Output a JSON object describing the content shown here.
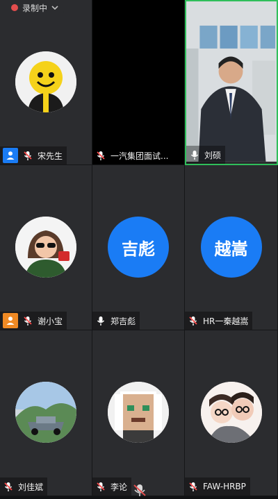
{
  "recording": {
    "label": "录制中"
  },
  "tiles": [
    {
      "name": "宋先生"
    },
    {
      "name": "一汽集团面试..."
    },
    {
      "name": "刘硕"
    },
    {
      "name": "谢小宝"
    },
    {
      "name": "郑吉彪",
      "initials": "吉彪"
    },
    {
      "name": "HR一秦越嵩",
      "initials": "越嵩"
    },
    {
      "name": "刘佳斌"
    },
    {
      "name": "李论"
    },
    {
      "name": "FAW-HRBP"
    }
  ],
  "colors": {
    "accent_blue": "#1a7cf5",
    "accent_orange": "#f08a24",
    "active_green": "#2fbf5b",
    "recording_red": "#e34d4d"
  }
}
